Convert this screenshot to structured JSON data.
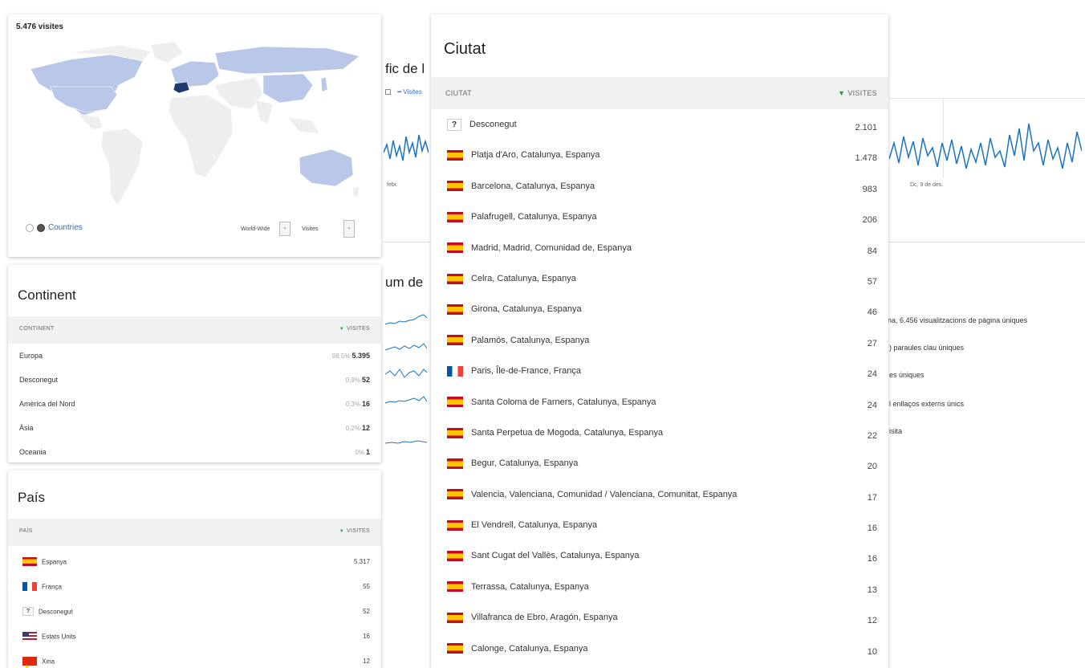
{
  "map_widget": {
    "visits_label": "5.476 visites",
    "countries_link": "Countries",
    "scope_select": "World-Wide",
    "metric_select": "Visites"
  },
  "background": {
    "chart_title_fragment": "fic de l",
    "legend_item": "Visites",
    "date_left": "febr.",
    "date_right": "Dc, 9 de des.",
    "summary_title_fragment": "um de",
    "summary_lines": [
      "na, 6.456 visualitzacions de pàgina úniques",
      ") paraules clau úniques",
      "es úniques",
      "l enllaços externs únics",
      "isita"
    ]
  },
  "continent": {
    "title": "Continent",
    "col_label": "CONTINENT",
    "col_value": "VISITES",
    "rows": [
      {
        "name": "Europa",
        "pct": "98,5%",
        "value": "5.395"
      },
      {
        "name": "Desconegut",
        "pct": "0,9%",
        "value": "52"
      },
      {
        "name": "Amèrica del Nord",
        "pct": "0,3%",
        "value": "16"
      },
      {
        "name": "Àsia",
        "pct": "0,2%",
        "value": "12"
      },
      {
        "name": "Oceania",
        "pct": "0%",
        "value": "1"
      }
    ]
  },
  "pais": {
    "title": "País",
    "col_label": "PAÍS",
    "col_value": "VISITES",
    "rows": [
      {
        "name": "Espanya",
        "flag": "flag-es",
        "value": "5.317"
      },
      {
        "name": "França",
        "flag": "flag-fr",
        "value": "55"
      },
      {
        "name": "Desconegut",
        "flag": "unknown",
        "value": "52"
      },
      {
        "name": "Estats Units",
        "flag": "flag-us",
        "value": "16"
      },
      {
        "name": "Xina",
        "flag": "flag-cn",
        "value": "12"
      }
    ]
  },
  "ciutat": {
    "title": "Ciutat",
    "col_label": "CIUTAT",
    "col_value": "VISITES",
    "rows": [
      {
        "name": "Desconegut",
        "flag": "unknown",
        "value": "2.101"
      },
      {
        "name": "Platja d'Aro, Catalunya, Espanya",
        "flag": "flag-es",
        "value": "1.478"
      },
      {
        "name": "Barcelona, Catalunya, Espanya",
        "flag": "flag-es",
        "value": "983"
      },
      {
        "name": "Palafrugell, Catalunya, Espanya",
        "flag": "flag-es",
        "value": "206"
      },
      {
        "name": "Madrid, Madrid, Comunidad de, Espanya",
        "flag": "flag-es",
        "value": "84"
      },
      {
        "name": "Celra, Catalunya, Espanya",
        "flag": "flag-es",
        "value": "57"
      },
      {
        "name": "Girona, Catalunya, Espanya",
        "flag": "flag-es",
        "value": "46"
      },
      {
        "name": "Palamós, Catalunya, Espanya",
        "flag": "flag-es",
        "value": "27"
      },
      {
        "name": "Paris, Île-de-France, França",
        "flag": "flag-fr",
        "value": "24"
      },
      {
        "name": "Santa Coloma de Farners, Catalunya, Espanya",
        "flag": "flag-es",
        "value": "24"
      },
      {
        "name": "Santa Perpetua de Mogoda, Catalunya, Espanya",
        "flag": "flag-es",
        "value": "22"
      },
      {
        "name": "Begur, Catalunya, Espanya",
        "flag": "flag-es",
        "value": "20"
      },
      {
        "name": "Valencia, Valenciana, Comunidad / Valenciana, Comunitat, Espanya",
        "flag": "flag-es",
        "value": "17"
      },
      {
        "name": "El Vendrell, Catalunya, Espanya",
        "flag": "flag-es",
        "value": "16"
      },
      {
        "name": "Sant Cugat del Vallès, Catalunya, Espanya",
        "flag": "flag-es",
        "value": "16"
      },
      {
        "name": "Terrassa, Catalunya, Espanya",
        "flag": "flag-es",
        "value": "13"
      },
      {
        "name": "Villafranca de Ebro, Aragón, Espanya",
        "flag": "flag-es",
        "value": "12"
      },
      {
        "name": "Calonge, Catalunya, Espanya",
        "flag": "flag-es",
        "value": "10"
      }
    ]
  },
  "colors": {
    "map_highlight": "#b9c8e8",
    "map_base": "#eeeeee",
    "map_spain": "#1f3a6e",
    "line": "#1a73c0",
    "sort_arrow": "#2a9d3c"
  },
  "icons": [
    "zoom-out-icon",
    "globe-icon",
    "sort-desc-icon",
    "select-arrow-icon",
    "unknown-flag-icon"
  ]
}
